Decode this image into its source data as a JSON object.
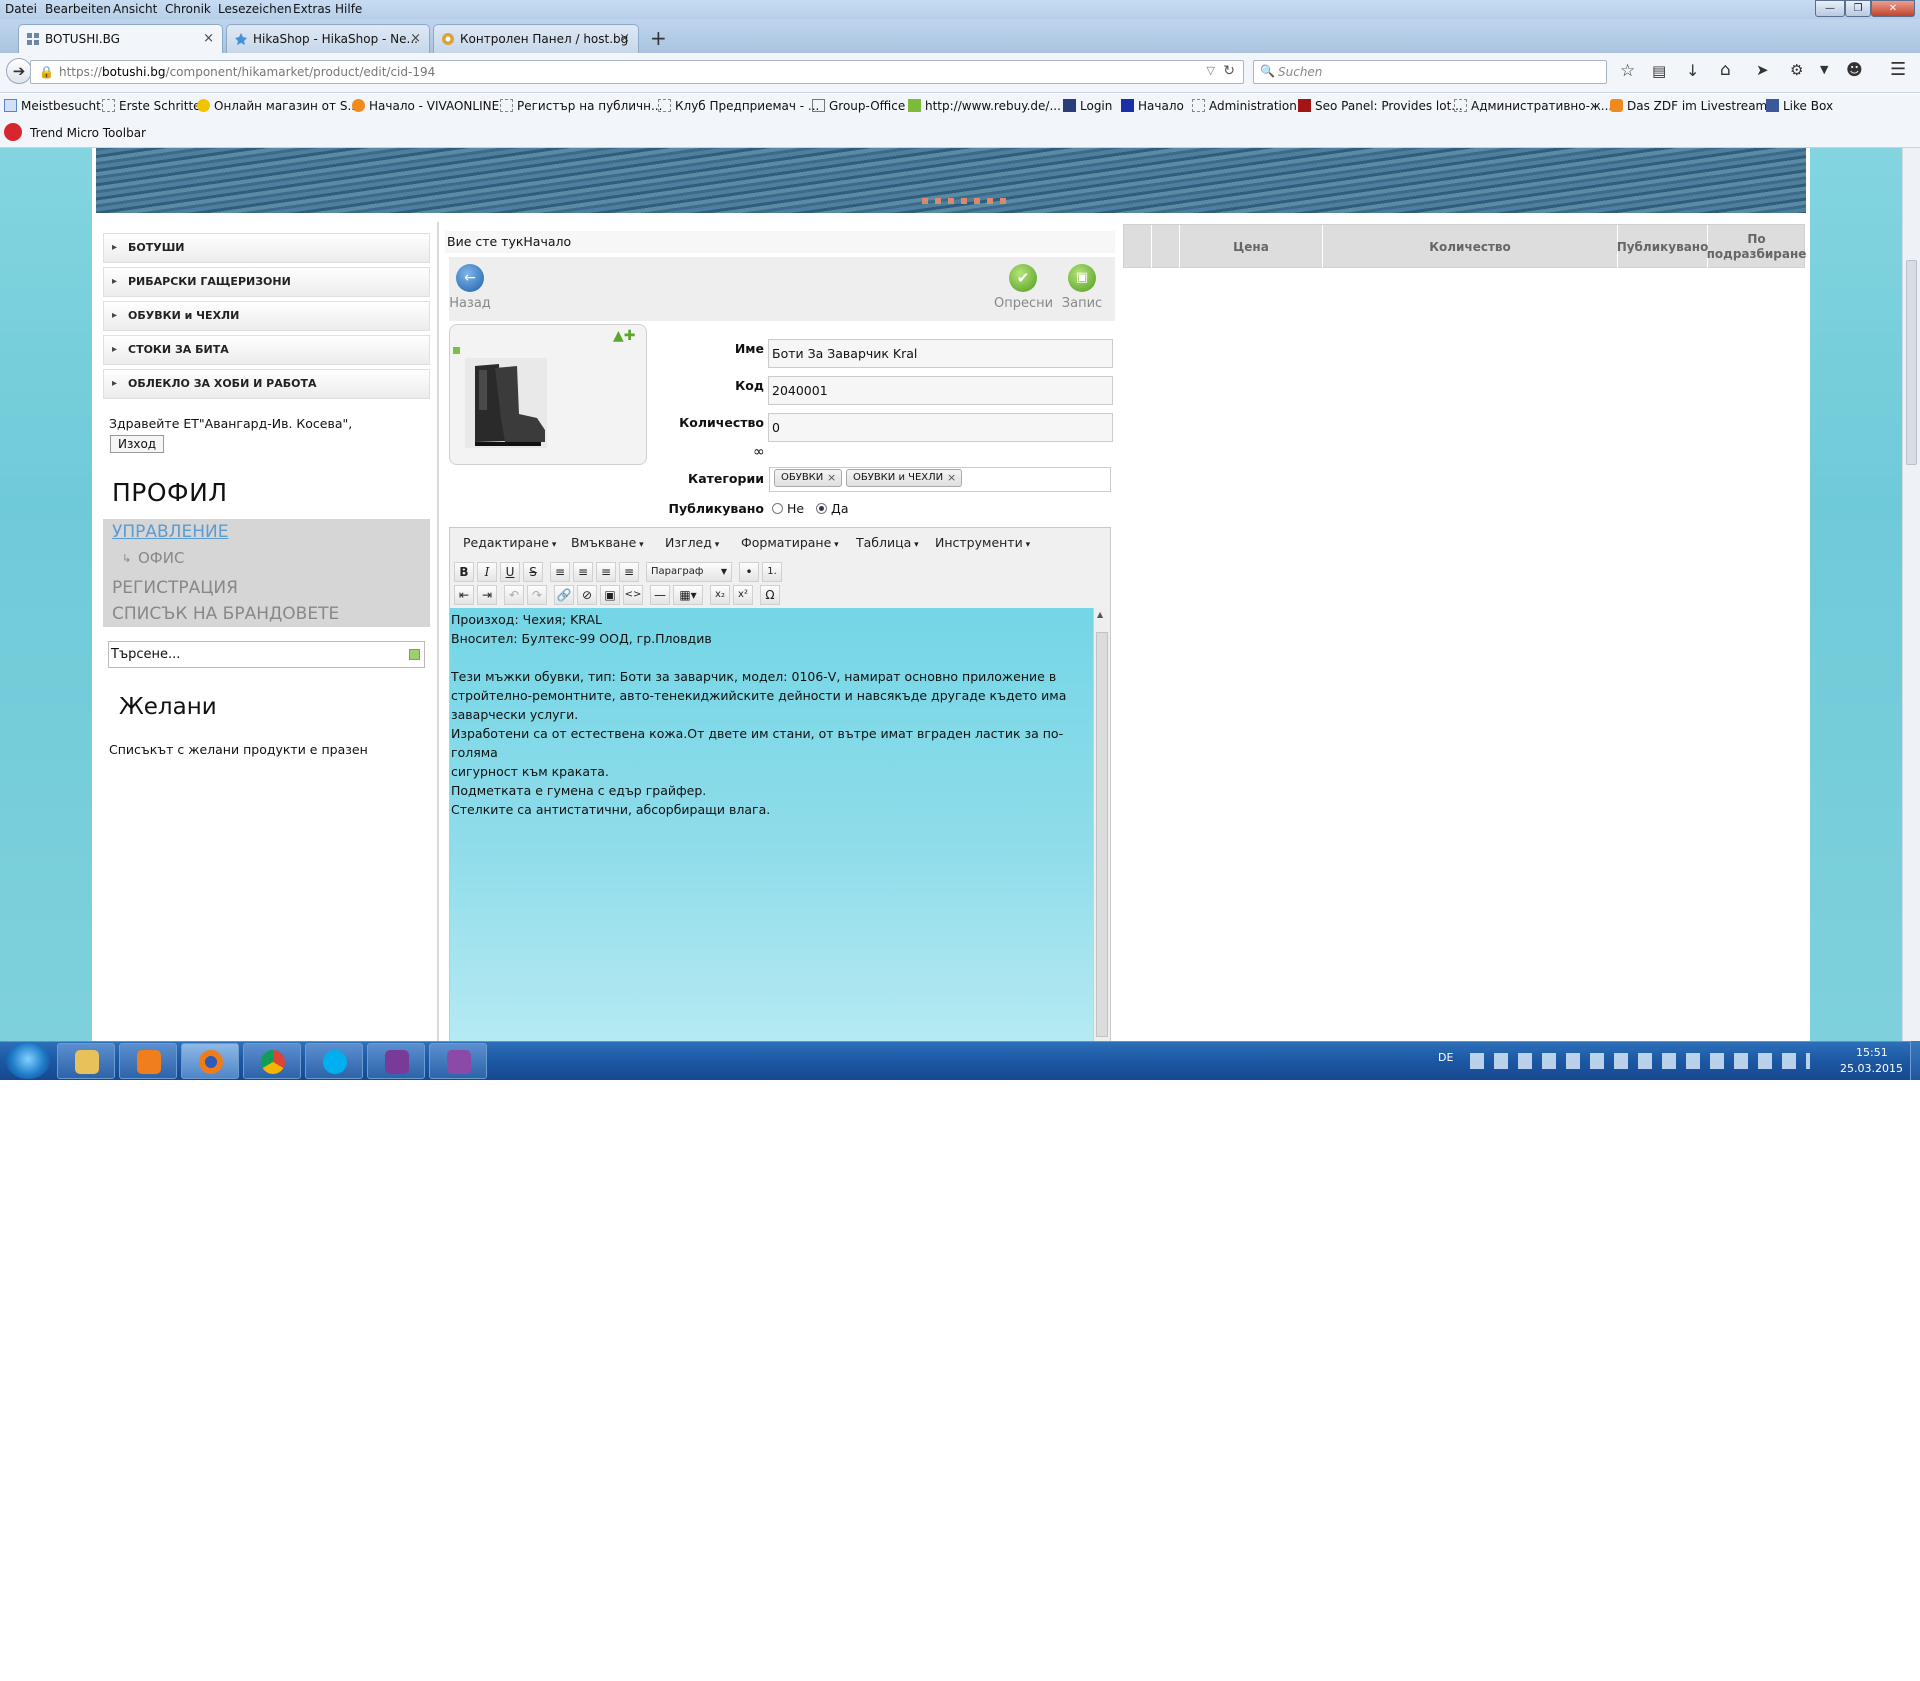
{
  "browser": {
    "menu": [
      "Datei",
      "Bearbeiten",
      "Ansicht",
      "Chronik",
      "Lesezeichen",
      "Extras",
      "Hilfe"
    ],
    "tabs": [
      {
        "title": "BOTUSHI.BG"
      },
      {
        "title": "HikaShop - HikaShop - Ne..."
      },
      {
        "title": "Контролен Панел / host.bg"
      }
    ],
    "new_tab": "+",
    "url_prefix": "https://",
    "url_domain": "botushi.bg",
    "url_path": "/component/hikamarket/product/edit/cid-194",
    "search_placeholder": "Suchen",
    "bookmarks": [
      "Meistbesucht",
      "Erste Schritte",
      "Онлайн магазин от S...",
      "Начало - VIVAONLINE",
      "Регистър на публичн...",
      "Клуб Предприемач - ...",
      "Group-Office",
      "http://www.rebuy.de/...",
      "Login",
      "Начало",
      "Administration",
      "Seo Panel: Provides lot...",
      "Административно-ж...",
      "Das ZDF im Livestream...",
      "Like Box"
    ],
    "toolbar_label": "Trend Micro Toolbar"
  },
  "sidebar": {
    "categories": [
      "БОТУШИ",
      "РИБАРСКИ ГАЩЕРИЗОНИ",
      "ОБУВКИ и ЧЕХЛИ",
      "СТОКИ ЗА БИТА",
      "ОБЛЕКЛО ЗА ХОБИ И РАБОТА"
    ],
    "greeting": "Здравейте ЕТ\"Авангард-Ив. Косева\",",
    "logout": "Изход",
    "profile_title": "ПРОФИЛ",
    "menu": [
      {
        "label": "УПРАВЛЕНИЕ"
      },
      {
        "label": "ОФИС"
      },
      {
        "label": "РЕГИСТРАЦИЯ"
      },
      {
        "label": "СПИСЪК НА БРАНДОВЕТЕ"
      }
    ],
    "search_text": "Търсене...",
    "wishlist_title": "Желани",
    "wishlist_empty": "Списъкът с желани продукти е празен"
  },
  "main": {
    "breadcrumb": "Вие сте тукНачало",
    "buttons": {
      "back": "Назад",
      "refresh": "Опресни",
      "save": "Запис"
    },
    "labels": {
      "name": "Име",
      "code": "Код",
      "quantity": "Количество",
      "categories": "Категории",
      "published": "Публикувано"
    },
    "values": {
      "name": "Боти За Заварчик Kral",
      "code": "2040001",
      "quantity": "0",
      "unlimited": "∞"
    },
    "categories": [
      "ОБУВКИ",
      "ОБУВКИ и ЧЕХЛИ"
    ],
    "published_options": {
      "no": "Не",
      "yes": "Да",
      "selected": "Да"
    },
    "editor": {
      "menu": [
        "Редактиране",
        "Вмъкване",
        "Изглед",
        "Форматиране",
        "Таблица",
        "Инструменти"
      ],
      "format": "Параграф",
      "lines": [
        "Произход: Чехия; KRAL",
        "Вносител: Бултекс-99 ООД, гр.Пловдив",
        "",
        "Тези мъжки обувки, тип: Боти за заварчик, модел: 0106-V, намират основно приложение в",
        "стройтелно-ремонтните, авто-тенекиджийските дейности и навсякъде другаде където има",
        "заварчески услуги.",
        "Изработени са от естествена кожа.От двете им стани, от вътре имат вграден ластик за по-голяма",
        "сигурност към краката.",
        "Подметката е гумена с едър грайфер.",
        "Стелките са антистатични, абсорбиращи влага."
      ]
    }
  },
  "table": {
    "headers": [
      "Цена",
      "Количество",
      "Публикувано",
      "По подразбиране"
    ]
  },
  "taskbar": {
    "language": "DE",
    "time": "15:51",
    "date": "25.03.2015"
  },
  "colors": {
    "accent_link": "#5b9bd0",
    "page_bg": "#7ed1dc",
    "taskbar": "#1d5aa5"
  }
}
